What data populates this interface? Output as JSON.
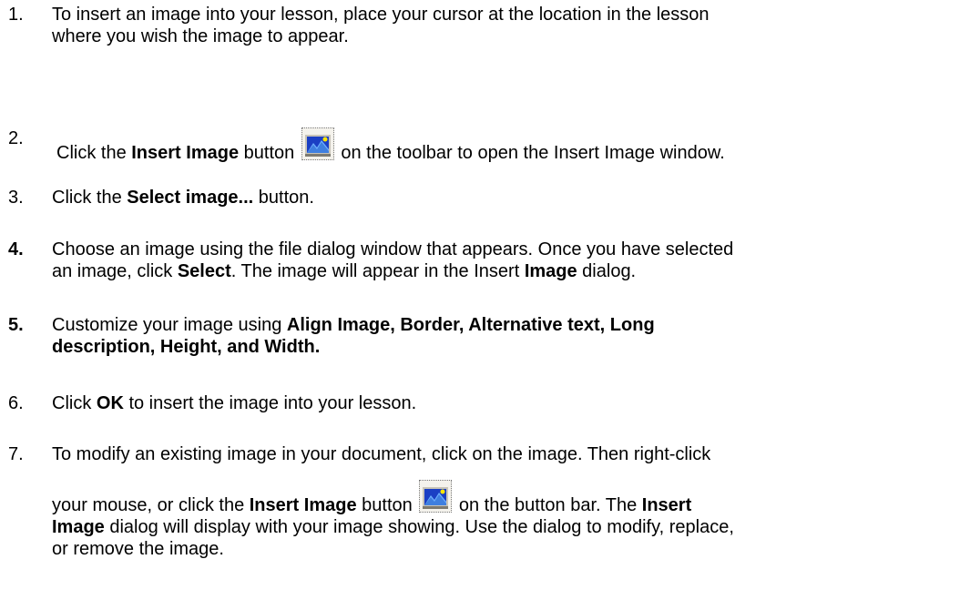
{
  "steps": [
    {
      "number": "1.",
      "lines": [
        "To insert an image into your lesson, place your cursor at the location in the lesson",
        "where you wish the image to appear."
      ]
    },
    {
      "number": "2.",
      "before_bold": "Click the ",
      "bold": "Insert Image",
      "after_bold": " button",
      "icon": "insert-image-icon",
      "after_icon": " on the toolbar to open the Insert Image window."
    },
    {
      "number": "3.",
      "before_bold": "Click the ",
      "bold": "Select image...",
      "after_bold": " button."
    },
    {
      "number": "4.",
      "line1": "Choose an image using the file dialog window that appears.  Once you have selected",
      "line2_a": "an image, click ",
      "line2_bold1": "Select",
      "line2_b": ". The image will appear in the Insert ",
      "line2_bold2": "Image",
      "line2_c": " dialog."
    },
    {
      "number": "5.",
      "before_bold": "Customize your image using ",
      "bold_line1": "Align Image, Border, Alternative text, Long",
      "bold_line2": "description, Height, and Width."
    },
    {
      "number": "6.",
      "before_bold": "Click ",
      "bold": "OK",
      "after_bold": " to insert the image into your lesson."
    },
    {
      "number": "7.",
      "line1": "To modify an existing image in your document, click on the image. Then right-click",
      "line2_a": "your mouse, or click the ",
      "line2_bold1": "Insert Image",
      "line2_b": " button",
      "line2_c": " on the button bar. The ",
      "line2_bold2": "Insert",
      "line3_bold": "Image",
      "line3_rest": " dialog will display with your image showing. Use the dialog to modify, replace,",
      "line4": "or remove the image."
    }
  ],
  "colors": {
    "text": "#000000",
    "icon_sky": "#1b3fc4",
    "icon_mountain": "#3f7fdf",
    "icon_sun": "#ffe600"
  }
}
